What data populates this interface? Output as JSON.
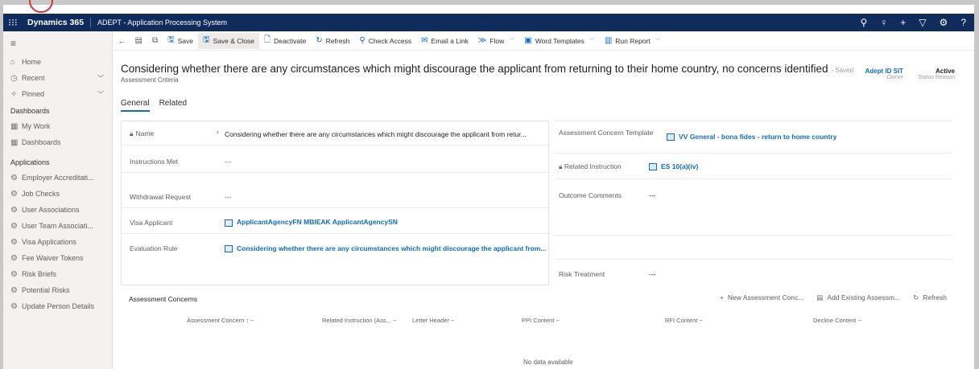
{
  "topbar": {
    "app_name": "Dynamics 365",
    "app_sub": "ADEPT - Application Processing System",
    "icons": [
      "search-icon",
      "lightbulb-icon",
      "plus-icon",
      "filter-icon",
      "gear-icon",
      "help-icon"
    ]
  },
  "sidebar": {
    "items_top": [
      {
        "label": "Home",
        "icon": "home-icon"
      },
      {
        "label": "Recent",
        "icon": "clock-icon"
      },
      {
        "label": "Pinned",
        "icon": "pin-icon"
      }
    ],
    "dashboards_title": "Dashboards",
    "dashboards": [
      {
        "label": "My Work"
      },
      {
        "label": "Dashboards"
      }
    ],
    "applications_title": "Applications",
    "applications": [
      {
        "label": "Employer Accreditati..."
      },
      {
        "label": "Job Checks"
      },
      {
        "label": "User Associations"
      },
      {
        "label": "User Team Associati..."
      },
      {
        "label": "Visa Applications"
      },
      {
        "label": "Fee Waiver Tokens"
      },
      {
        "label": "Risk Briefs"
      },
      {
        "label": "Potential Risks"
      },
      {
        "label": "Update Person Details"
      }
    ]
  },
  "commands": {
    "save": "Save",
    "save_close": "Save & Close",
    "deactivate": "Deactivate",
    "refresh": "Refresh",
    "check_access": "Check Access",
    "email_link": "Email a Link",
    "flow": "Flow",
    "word_templates": "Word Templates",
    "run_report": "Run Report"
  },
  "header": {
    "title": "Considering whether there are any circumstances which might discourage the applicant from returning to their home country, no concerns identified",
    "saved": "- Saved",
    "entity": "Assessment Criteria",
    "owner_value": "Adept ID SIT",
    "owner_label": "Owner",
    "status_value": "Active",
    "status_label": "Status Reason"
  },
  "tabs": [
    "General",
    "Related"
  ],
  "form_left": {
    "name_label": "Name",
    "name_value": "Considering whether there are any circumstances which might discourage the applicant from retur...",
    "instructions_label": "Instructions Met",
    "instructions_value": "---",
    "withdrawal_label": "Withdrawal Request",
    "withdrawal_value": "---",
    "visa_label": "Visa Applicant",
    "visa_value": "ApplicantAgencyFN MBIEAK ApplicantAgencySN",
    "eval_label": "Evaluation Rule",
    "eval_value": "Considering whether there are any circumstances which might discourage the applicant from..."
  },
  "form_right": {
    "template_label": "Assessment Concern Template",
    "template_value": "VV General - bona fides - return to home country",
    "related_label": "Related Instruction",
    "related_value": "ES 10(a)(iv)",
    "outcome_label": "Outcome Comments",
    "outcome_value": "---",
    "risk_label": "Risk Treatment",
    "risk_value": "---"
  },
  "subgrid": {
    "title": "Assessment Concerns",
    "new_btn": "New Assessment Conc...",
    "add_btn": "Add Existing Assessm...",
    "refresh_btn": "Refresh",
    "columns": [
      "Assessment Concern ↑ ~",
      "Related Instruction (Ass... ~",
      "Letter Header ~",
      "PPI Content ~",
      "RFI Content ~",
      "Decline Content ~"
    ],
    "empty": "No data available"
  }
}
